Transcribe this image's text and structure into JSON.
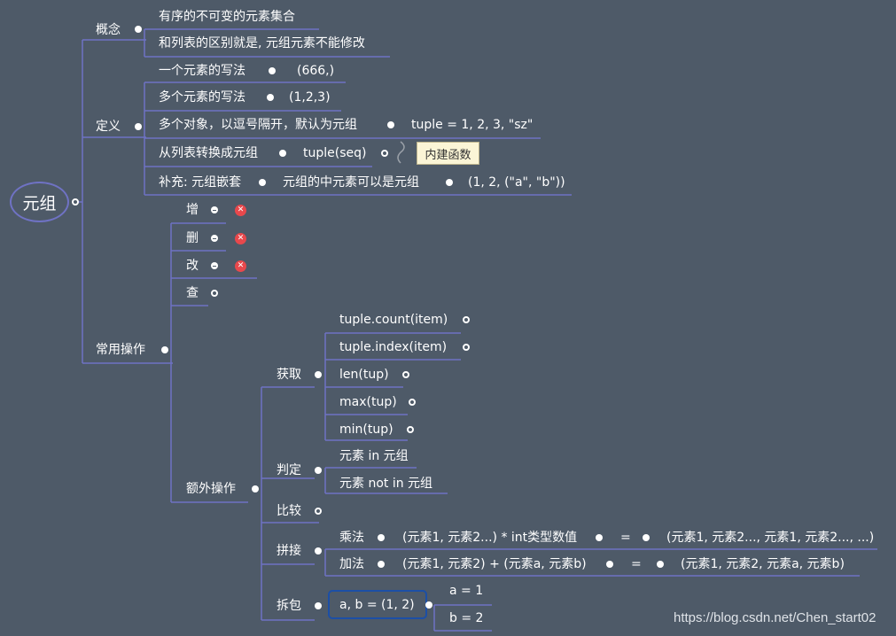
{
  "root": {
    "label": "元组"
  },
  "concept": {
    "label": "概念",
    "items": [
      "有序的不可变的元素集合",
      "和列表的区别就是, 元组元素不能修改"
    ]
  },
  "definition": {
    "label": "定义",
    "single_label": "一个元素的写法",
    "single_value": "(666,)",
    "multi_label": "多个元素的写法",
    "multi_value": "(1,2,3)",
    "objects_label": "多个对象，以逗号隔开，默认为元组",
    "objects_value": "tuple = 1, 2, 3, \"sz\"",
    "convert_label": "从列表转换成元组",
    "convert_value": "tuple(seq)",
    "convert_note": "内建函数",
    "nest_label": "补充: 元组嵌套",
    "nest_desc": "元组的中元素可以是元组",
    "nest_value": "(1, 2, (\"a\", \"b\"))"
  },
  "ops": {
    "label": "常用操作",
    "add": "增",
    "del": "删",
    "mod": "改",
    "query": "查",
    "extra": {
      "label": "额外操作",
      "get": {
        "label": "获取",
        "items": [
          "tuple.count(item)",
          "tuple.index(item)",
          "len(tup)",
          "max(tup)",
          "min(tup)"
        ]
      },
      "judge": {
        "label": "判定",
        "items": [
          "元素 in  元组",
          "元素 not in 元组"
        ]
      },
      "compare": "比较",
      "concat": {
        "label": "拼接",
        "mul_label": "乘法",
        "mul_expr": "(元素1, 元素2...) * int类型数值",
        "mul_eq": "=",
        "mul_result": "(元素1, 元素2..., 元素1, 元素2..., ...)",
        "add_label": "加法",
        "add_expr": "(元素1, 元素2) + (元素a, 元素b)",
        "add_eq": "=",
        "add_result": "(元素1, 元素2, 元素a, 元素b)"
      },
      "unpack": {
        "label": "拆包",
        "expr": "a, b = (1, 2)",
        "a": "a = 1",
        "b": "b = 2"
      }
    }
  },
  "watermark": "https://blog.csdn.net/Chen_start02",
  "colors": {
    "background": "#4e5a68",
    "branch": "#6f72c4",
    "delete_icon": "#e8484c",
    "callout": "#fbf5d6"
  }
}
